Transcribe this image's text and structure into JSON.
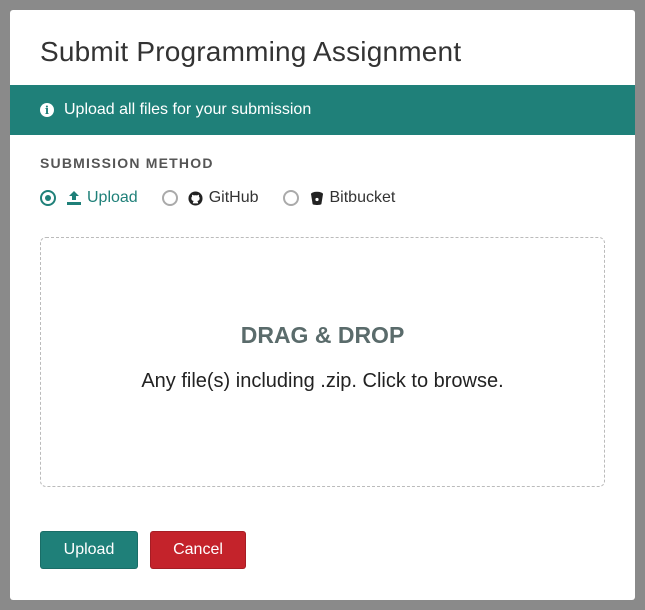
{
  "modal": {
    "title": "Submit Programming Assignment"
  },
  "banner": {
    "icon": "info-icon",
    "text": "Upload all files for your submission",
    "color": "#1f8079"
  },
  "submission_method": {
    "label": "SUBMISSION METHOD",
    "selected": "Upload",
    "options": [
      {
        "label": "Upload",
        "icon": "upload-icon",
        "checked": true
      },
      {
        "label": "GitHub",
        "icon": "github-icon",
        "checked": false
      },
      {
        "label": "Bitbucket",
        "icon": "bitbucket-icon",
        "checked": false
      }
    ]
  },
  "dropzone": {
    "title": "DRAG & DROP",
    "subtitle": "Any file(s) including .zip. Click to browse."
  },
  "buttons": {
    "upload": "Upload",
    "cancel": "Cancel"
  },
  "colors": {
    "accent": "#1f8079",
    "danger": "#c4232b"
  }
}
